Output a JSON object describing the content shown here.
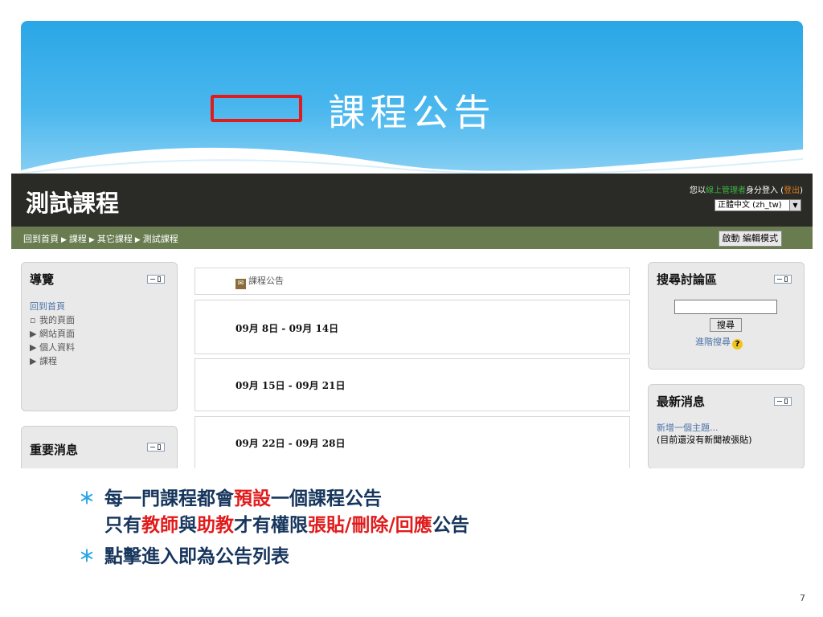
{
  "slide": {
    "title": "課程公告",
    "page_number": "7"
  },
  "moodle": {
    "site_title": "測試課程",
    "login": {
      "prefix": "您以",
      "role_link": "線上管理者",
      "middle": "身分登入 (",
      "logout": "登出",
      "suffix": ")"
    },
    "language_select": "正體中文 (zh_tw)",
    "breadcrumb": [
      "回到首頁",
      "課程",
      "其它課程",
      "測試課程"
    ],
    "breadcrumb_separator": "▶",
    "edit_button": "啟動 編輯模式",
    "nav_block": {
      "title": "導覽",
      "home": "回到首頁",
      "items": [
        {
          "bullet": "▫",
          "label": "我的頁面"
        },
        {
          "bullet": "▶",
          "label": "網站頁面"
        },
        {
          "bullet": "▶",
          "label": "個人資料"
        },
        {
          "bullet": "▶",
          "label": "課程"
        }
      ]
    },
    "news_left_block": {
      "title": "重要消息"
    },
    "forum_link": "課程公告",
    "weeks": [
      "09月 8日 - 09月 14日",
      "09月 15日 - 09月 21日",
      "09月 22日 - 09月 28日"
    ],
    "search_block": {
      "title": "搜尋討論區",
      "button": "搜尋",
      "advanced": "進階搜尋"
    },
    "latest_news_block": {
      "title": "最新消息",
      "add_topic": "新增一個主題...",
      "empty": "(目前還沒有新聞被張貼)"
    }
  },
  "notes": {
    "bullet": "＊",
    "line1": {
      "a": "每一門課程都會",
      "b": "預設",
      "c": "一個課程公告"
    },
    "line2": {
      "a": "只有",
      "b": "教師",
      "c": "與",
      "d": "助教",
      "e": "才有權限",
      "f": "張貼/刪除/回應",
      "g": "公告"
    },
    "line3": "點擊進入即為公告列表"
  },
  "colors": {
    "banner_blue": "#2aa6e6",
    "topbar": "#2a2a27",
    "navbar": "#687c4f",
    "highlight_red": "#e11b1b",
    "note_text": "#17365d"
  }
}
